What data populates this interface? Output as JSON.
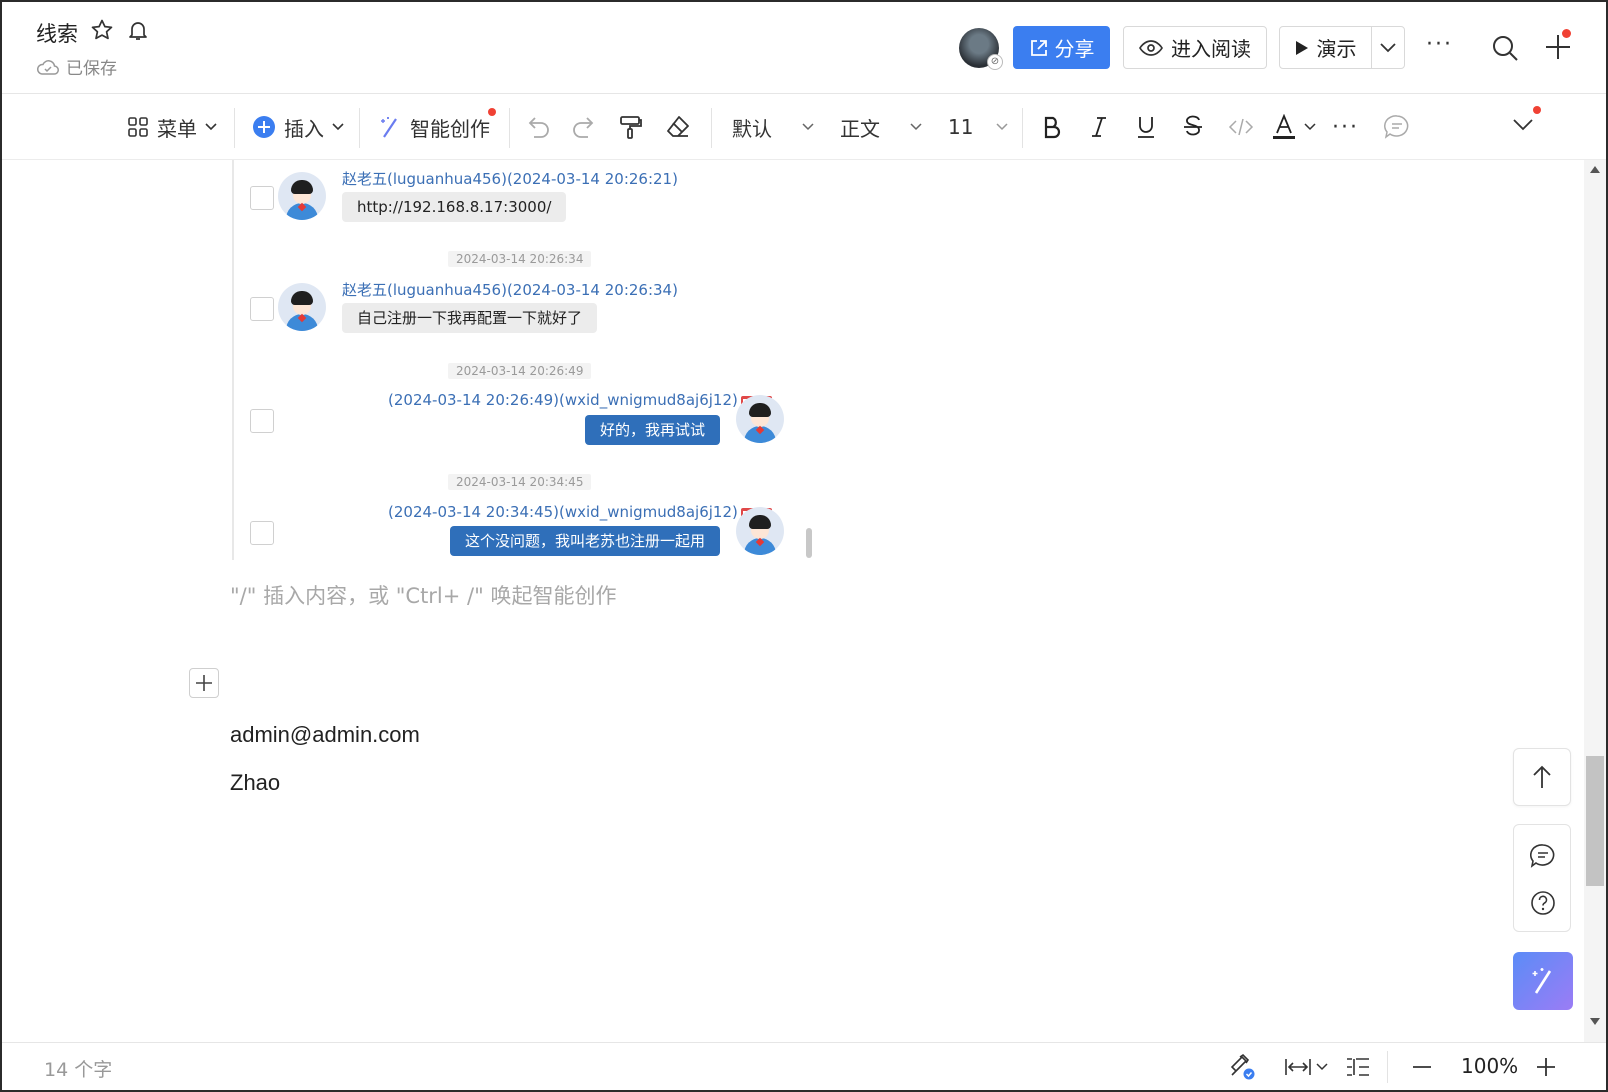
{
  "header": {
    "title": "线索",
    "saved_text": "已保存",
    "avatar_badge": "⊘",
    "share_label": "分享",
    "read_label": "进入阅读",
    "present_label": "演示"
  },
  "toolbar": {
    "menu_label": "菜单",
    "insert_label": "插入",
    "ai_label": "智能创作",
    "style_default": "默认",
    "paragraph_style": "正文",
    "font_size": "11"
  },
  "chat": {
    "messages": [
      {
        "sender_meta": "赵老五(luguanhua456)(2024-03-14 20:26:21)",
        "text": "http://192.168.8.17:3000/",
        "direction": "in"
      },
      {
        "timestamp": "2024-03-14 20:26:34",
        "sender_meta": "赵老五(luguanhua456)(2024-03-14 20:26:34)",
        "text": "自己注册一下我再配置一下就好了",
        "direction": "in"
      },
      {
        "timestamp": "2024-03-14 20:26:49",
        "sender_meta": "(2024-03-14 20:26:49)(wxid_wnigmud8aj6j12)",
        "text": "好的，我再试试",
        "direction": "out"
      },
      {
        "timestamp": "2024-03-14 20:34:45",
        "sender_meta": "(2024-03-14 20:34:45)(wxid_wnigmud8aj6j12)",
        "text": "这个没问题，我叫老苏也注册一起用",
        "direction": "out"
      }
    ]
  },
  "editor": {
    "placeholder": "\"/\" 插入内容，或 \"Ctrl+ /\" 唤起智能创作",
    "paragraphs": [
      "admin@admin.com",
      "Zhao"
    ]
  },
  "status": {
    "word_count": "14 个字",
    "zoom": "100%"
  },
  "colors": {
    "accent": "#3b7ef0",
    "out_bubble": "#2f6fba",
    "meta_text": "#3b6fb5"
  }
}
